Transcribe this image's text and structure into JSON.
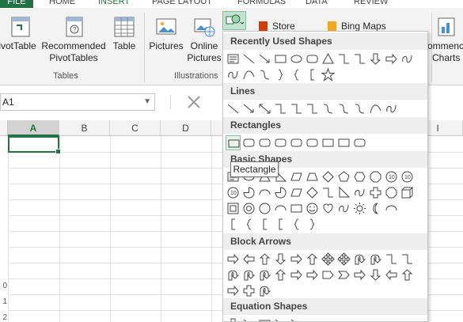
{
  "tabs": [
    "FILE",
    "HOME",
    "INSERT",
    "PAGE LAYOUT",
    "FORMULAS",
    "DATA",
    "REVIEW"
  ],
  "ribbon": {
    "pivot_label": "PivotTable",
    "recpivot_label1": "Recommended",
    "recpivot_label2": "PivotTables",
    "table_label": "Table",
    "tables_group": "Tables",
    "pictures_label": "Pictures",
    "online1": "Online",
    "online2": "Pictures",
    "illus_group": "Illustrations",
    "store_label": "Store",
    "bing_label": "Bing Maps",
    "rec_charts1": "ommenc",
    "rec_charts2": "Charts"
  },
  "namebox": {
    "value": "A1"
  },
  "grid": {
    "columns": [
      "A",
      "B",
      "C",
      "D",
      "I"
    ],
    "rows": [
      "",
      "",
      "",
      "",
      "",
      "",
      "",
      "",
      "0",
      "1",
      "2"
    ]
  },
  "gallery": {
    "sections": [
      "Recently Used Shapes",
      "Lines",
      "Rectangles",
      "Basic Shapes",
      "Block Arrows",
      "Equation Shapes"
    ],
    "tooltip": "Rectangle"
  },
  "colors": {
    "accent": "#217346",
    "ribbon_bg": "#f3f3f3",
    "section_bg": "#eeeeee"
  }
}
